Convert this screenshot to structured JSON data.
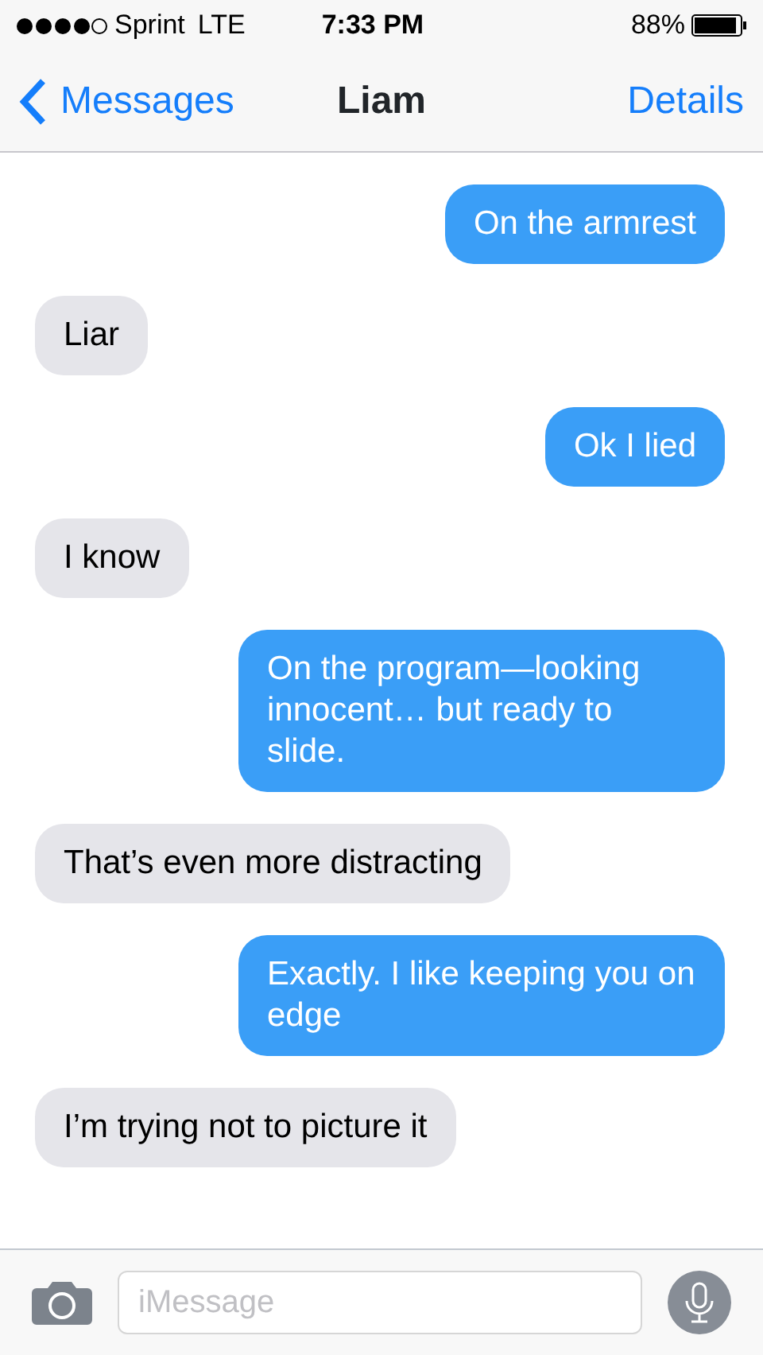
{
  "status_bar": {
    "carrier": "Sprint",
    "network": "LTE",
    "time": "7:33 PM",
    "battery": "88%"
  },
  "nav": {
    "back": "Messages",
    "title": "Liam",
    "action": "Details"
  },
  "messages": [
    {
      "kind": "sent",
      "text": "On the armrest"
    },
    {
      "kind": "received",
      "text": "Liar"
    },
    {
      "kind": "sent",
      "text": "Ok I lied"
    },
    {
      "kind": "received",
      "text": "I know"
    },
    {
      "kind": "sent",
      "text": "On the program—looking innocent… but ready to slide."
    },
    {
      "kind": "received",
      "text": "That’s even more distracting"
    },
    {
      "kind": "sent",
      "text": "Exactly. I like keeping you on edge"
    },
    {
      "kind": "received",
      "text": "I’m trying not to picture it"
    }
  ],
  "composer": {
    "placeholder": "iMessage"
  }
}
